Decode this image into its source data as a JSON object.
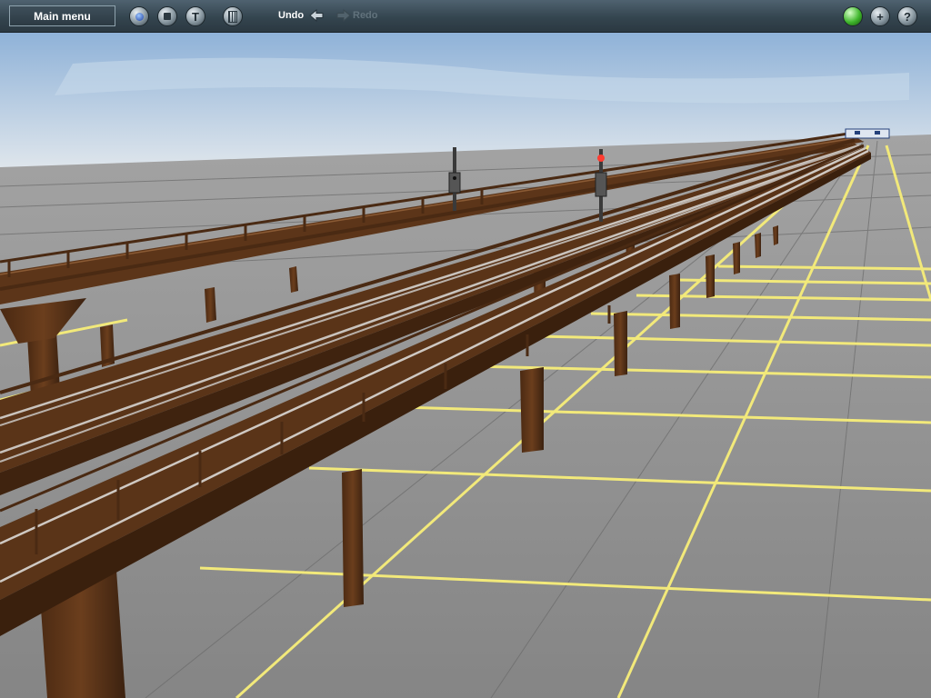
{
  "toolbar": {
    "main_menu_label": "Main menu",
    "undo_label": "Undo",
    "redo_label": "Redo",
    "left_icons": [
      "camera-icon",
      "stop-icon",
      "tool-icon",
      "layers-icon"
    ],
    "right_icons": [
      "green-status-icon",
      "plus-icon",
      "help-icon"
    ],
    "plus_glyph": "+",
    "help_glyph": "?",
    "tool_glyph": "T",
    "colors": {
      "toolbar_bg": "#34454f",
      "grid_line": "#f2e97a",
      "ground": "#8c8c8c",
      "sky_top": "#a9c4e0",
      "timber": "#5a3418"
    }
  },
  "scene": {
    "description_icons": [
      "elevated-wooden-trestle-track",
      "signal-post-icon",
      "signal-post-red-icon",
      "ground-grid"
    ]
  }
}
